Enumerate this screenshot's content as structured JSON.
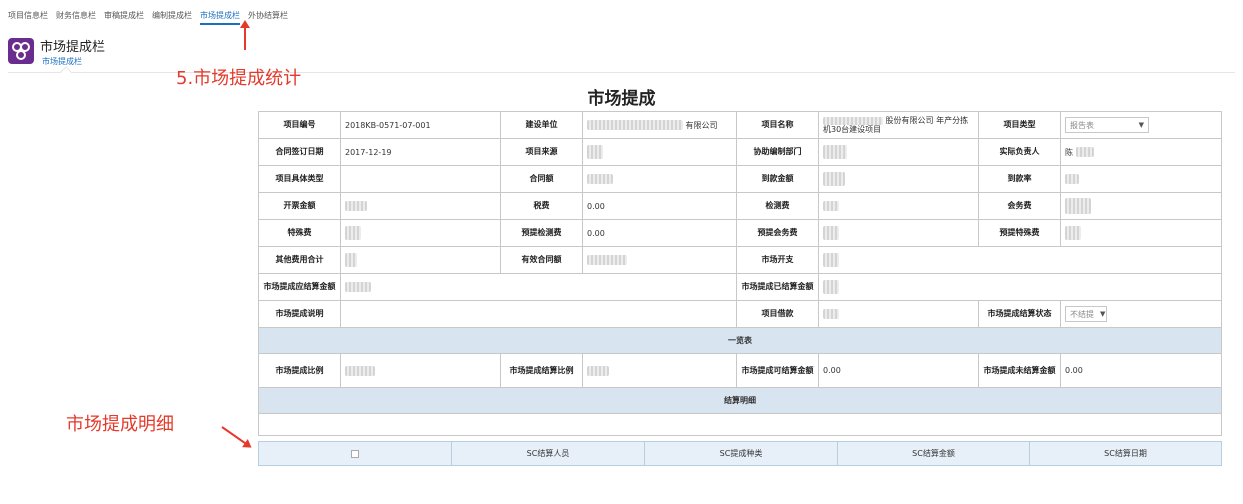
{
  "topnav": {
    "items": [
      "项目信息栏",
      "财务信息栏",
      "审稿提成栏",
      "编制提成栏",
      "市场提成栏",
      "外协结算栏"
    ],
    "active_index": 4
  },
  "module": {
    "title": "市场提成栏",
    "subtitle": "市场提成栏",
    "icon": "group-icon",
    "icon_color": "#6a2c8e"
  },
  "annotations": {
    "stat": "5.市场提成统计",
    "detail": "市场提成明细",
    "color": "#e43a2b"
  },
  "form": {
    "title": "市场提成",
    "rows": [
      [
        {
          "label": "项目编号",
          "value": "2018KB-0571-07-001"
        },
        {
          "label": "建设单位",
          "value": "有限公司",
          "redacted": true
        },
        {
          "label": "项目名称",
          "value": "股份有限公司 年产分拣机30台建设项目",
          "redacted": true
        },
        {
          "label": "项目类型",
          "select": "报告表"
        }
      ],
      [
        {
          "label": "合同签订日期",
          "value": "2017-12-19"
        },
        {
          "label": "项目来源",
          "value": "",
          "redacted": true
        },
        {
          "label": "协助编制部门",
          "value": "",
          "redacted": true
        },
        {
          "label": "实际负责人",
          "value": "陈",
          "redacted": true
        }
      ],
      [
        {
          "label": "项目具体类型",
          "value": ""
        },
        {
          "label": "合同额",
          "value": "",
          "redacted": true
        },
        {
          "label": "到款金额",
          "value": "",
          "redacted": true
        },
        {
          "label": "到款率",
          "value": "",
          "redacted": true
        }
      ],
      [
        {
          "label": "开票金额",
          "value": "",
          "redacted": true
        },
        {
          "label": "税费",
          "value": "0.00"
        },
        {
          "label": "检测费",
          "value": "",
          "redacted": true
        },
        {
          "label": "会务费",
          "value": "",
          "redacted": true
        }
      ],
      [
        {
          "label": "特殊费",
          "value": "",
          "redacted": true
        },
        {
          "label": "预提检测费",
          "value": "0.00"
        },
        {
          "label": "预提会务费",
          "value": "",
          "redacted": true
        },
        {
          "label": "预提特殊费",
          "value": "",
          "redacted": true
        }
      ]
    ],
    "other_row": {
      "other_total_label": "其他费用合计",
      "valid_contract_label": "有效合同额",
      "market_expense_label": "市场开支"
    },
    "settle_row": {
      "should_label": "市场提成应结算金额",
      "settled_label": "市场提成已结算金额"
    },
    "note_row": {
      "note_label": "市场提成说明",
      "loan_label": "项目借款",
      "status_label": "市场提成结算状态",
      "status_value": "不结提"
    },
    "overview_header": "一览表",
    "ratio_row": {
      "ratio_label": "市场提成比例",
      "settle_ratio_label": "市场提成结算比例",
      "can_settle_label": "市场提成可结算金额",
      "can_settle_value": "0.00",
      "unsettled_label": "市场提成未结算金额",
      "unsettled_value": "0.00"
    },
    "detail_header": "结算明细"
  },
  "detail_table": {
    "columns": [
      "SC结算人员",
      "SC提成种类",
      "SC结算金额",
      "SC结算日期"
    ]
  },
  "colors": {
    "accent": "#1a6fc4",
    "section_bg": "#d8e4f0",
    "detail_header_bg": "#e7f0f8"
  }
}
